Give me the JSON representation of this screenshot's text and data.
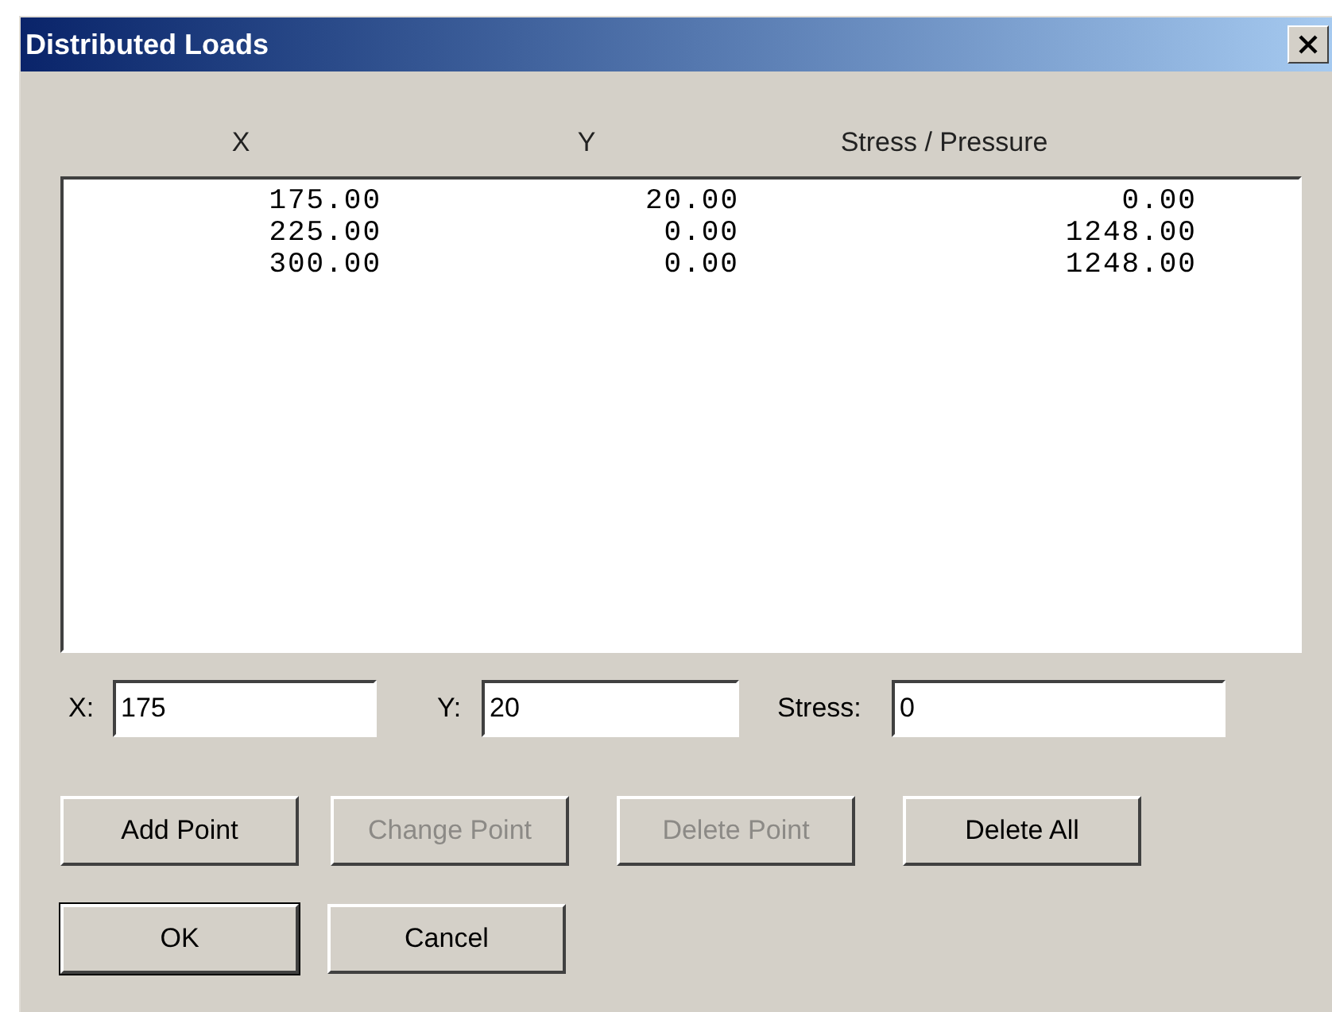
{
  "window": {
    "title": "Distributed Loads"
  },
  "table": {
    "columns": [
      "X",
      "Y",
      "Stress / Pressure"
    ],
    "rows": [
      [
        "175.00",
        "20.00",
        "0.00"
      ],
      [
        "225.00",
        "0.00",
        "1248.00"
      ],
      [
        "300.00",
        "0.00",
        "1248.00"
      ]
    ]
  },
  "fields": [
    {
      "label": "X:",
      "value": "175"
    },
    {
      "label": "Y:",
      "value": "20"
    },
    {
      "label": "Stress:",
      "value": "0"
    }
  ],
  "point_buttons": [
    {
      "label": "Add Point",
      "disabled": false
    },
    {
      "label": "Change Point",
      "disabled": true
    },
    {
      "label": "Delete Point",
      "disabled": true
    },
    {
      "label": "Delete All",
      "disabled": false
    }
  ],
  "dialog_buttons": [
    {
      "label": "OK",
      "default": true
    },
    {
      "label": "Cancel",
      "default": false
    }
  ]
}
